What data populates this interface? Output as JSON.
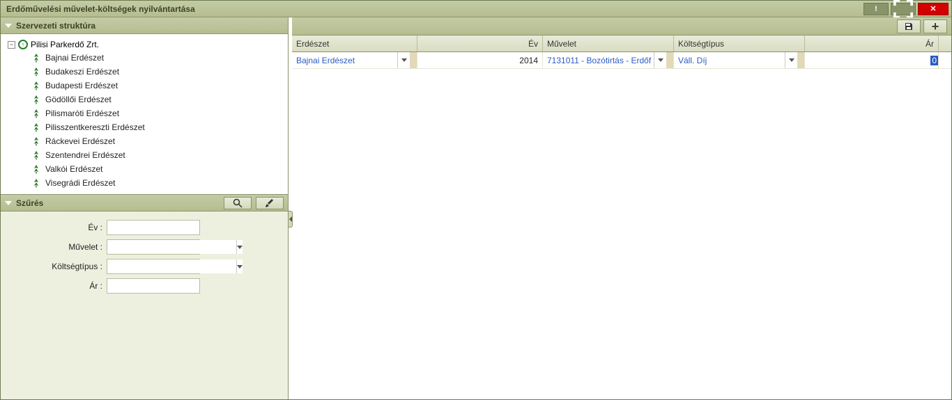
{
  "title": "Erdőművelési művelet-költségek nyilvántartása",
  "sidebar": {
    "structure_title": "Szervezeti struktúra",
    "root_label": "Pilisi Parkerdő Zrt.",
    "items": [
      {
        "label": "Bajnai Erdészet"
      },
      {
        "label": "Budakeszi Erdészet"
      },
      {
        "label": "Budapesti Erdészet"
      },
      {
        "label": "Gödöllői Erdészet"
      },
      {
        "label": "Pilismaróti Erdészet"
      },
      {
        "label": "Pilisszentkereszti Erdészet"
      },
      {
        "label": "Ráckevei Erdészet"
      },
      {
        "label": "Szentendrei Erdészet"
      },
      {
        "label": "Valkói Erdészet"
      },
      {
        "label": "Visegrádi Erdészet"
      }
    ],
    "filter_title": "Szűrés",
    "filters": {
      "ev_label": "Év :",
      "muvelet_label": "Művelet :",
      "koltsegtipus_label": "Költségtípus :",
      "ar_label": "Ár :",
      "ev_value": "",
      "muvelet_value": "",
      "koltsegtipus_value": "",
      "ar_value": ""
    }
  },
  "grid": {
    "headers": {
      "erdeszet": "Erdészet",
      "ev": "Év",
      "muvelet": "Művelet",
      "koltsegtipus": "Költségtípus",
      "ar": "Ár"
    },
    "rows": [
      {
        "erdeszet": "Bajnai Erdészet",
        "ev": "2014",
        "muvelet": "7131011 - Bozótirtás - Erdőf",
        "koltsegtipus": "Váll. Díj",
        "ar": "0"
      }
    ]
  },
  "colors": {
    "accent_green": "#b5bd8f",
    "link_blue": "#2a5bc4",
    "close_red": "#d40000"
  }
}
